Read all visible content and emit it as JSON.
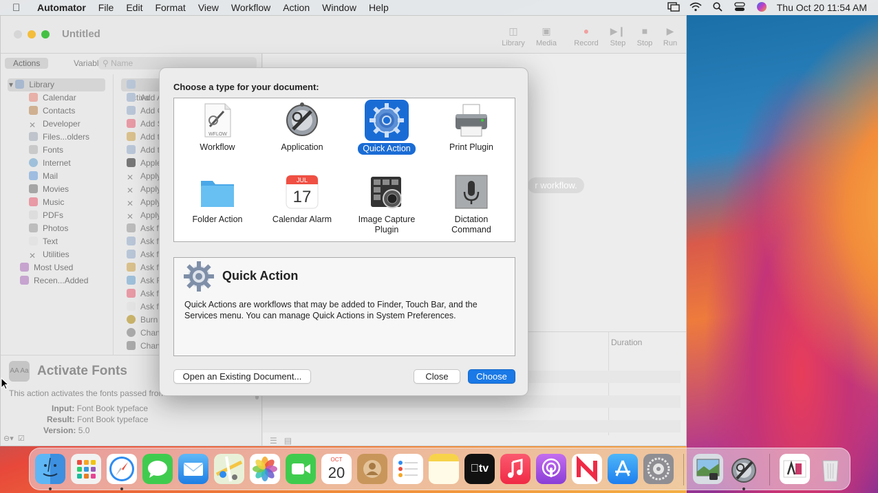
{
  "menubar": {
    "app_name": "Automator",
    "items": [
      "File",
      "Edit",
      "Format",
      "View",
      "Workflow",
      "Action",
      "Window",
      "Help"
    ],
    "clock": "Thu Oct 20  11:54 AM"
  },
  "window": {
    "title": "Untitled",
    "toolbar": [
      "Library",
      "Media",
      "Record",
      "Step",
      "Stop",
      "Run"
    ],
    "tabs": [
      "Actions",
      "Variables"
    ],
    "search_placeholder": "Name",
    "library": [
      "Library",
      "Calendar",
      "Contacts",
      "Developer",
      "Files...olders",
      "Fonts",
      "Internet",
      "Mail",
      "Movies",
      "Music",
      "PDFs",
      "Photos",
      "Text",
      "Utilities",
      "Most Used",
      "Recen...Added"
    ],
    "actions": [
      "Activa",
      "Add A",
      "Add C",
      "Add S",
      "Add t",
      "Add t",
      "Apple",
      "Apply",
      "Apply",
      "Apply",
      "Apply",
      "Ask fo",
      "Ask fo",
      "Ask fo",
      "Ask fo",
      "Ask F",
      "Ask fo",
      "Ask fo",
      "Burn",
      "Chan",
      "Chan"
    ],
    "hint": "r workflow.",
    "log_column": "Duration",
    "description": {
      "title": "Activate Fonts",
      "icon_text": "AA Aa",
      "text": "This action activates the fonts passed from",
      "input_label": "Input:",
      "input_value": "Font Book typeface",
      "result_label": "Result:",
      "result_value": "Font Book typeface",
      "version_label": "Version:",
      "version_value": "5.0"
    }
  },
  "dialog": {
    "title": "Choose a type for your document:",
    "types": [
      {
        "label": "Workflow",
        "icon": "workflow-icon"
      },
      {
        "label": "Application",
        "icon": "application-icon"
      },
      {
        "label": "Quick Action",
        "icon": "gear-icon"
      },
      {
        "label": "Print Plugin",
        "icon": "printer-icon"
      },
      {
        "label": "Folder Action",
        "icon": "folder-icon"
      },
      {
        "label": "Calendar Alarm",
        "icon": "calendar-icon"
      },
      {
        "label": "Image Capture Plugin",
        "icon": "camera-icon"
      },
      {
        "label": "Dictation Command",
        "icon": "microphone-icon"
      }
    ],
    "selected": "Quick Action",
    "wflow_text": "WFLOW",
    "cal_month": "JUL",
    "cal_day": "17",
    "info_title": "Quick Action",
    "info_text": "Quick Actions are workflows that may be added to Finder, Touch Bar, and the Services menu. You can manage Quick Actions in System Preferences.",
    "buttons": {
      "open": "Open an Existing Document...",
      "close": "Close",
      "choose": "Choose"
    }
  },
  "dock": {
    "calendar_month": "OCT",
    "calendar_day": "20",
    "apps": [
      "Finder",
      "Launchpad",
      "Safari",
      "Messages",
      "Mail",
      "Maps",
      "Photos",
      "FaceTime",
      "Calendar",
      "Contacts",
      "Reminders",
      "Notes",
      "TV",
      "Music",
      "Podcasts",
      "News",
      "App Store",
      "System Preferences",
      "Preview",
      "Automator",
      "Font Book",
      "Trash"
    ]
  },
  "colors": {
    "accent": "#1a6cd5",
    "button_primary": "#1a79e6"
  }
}
